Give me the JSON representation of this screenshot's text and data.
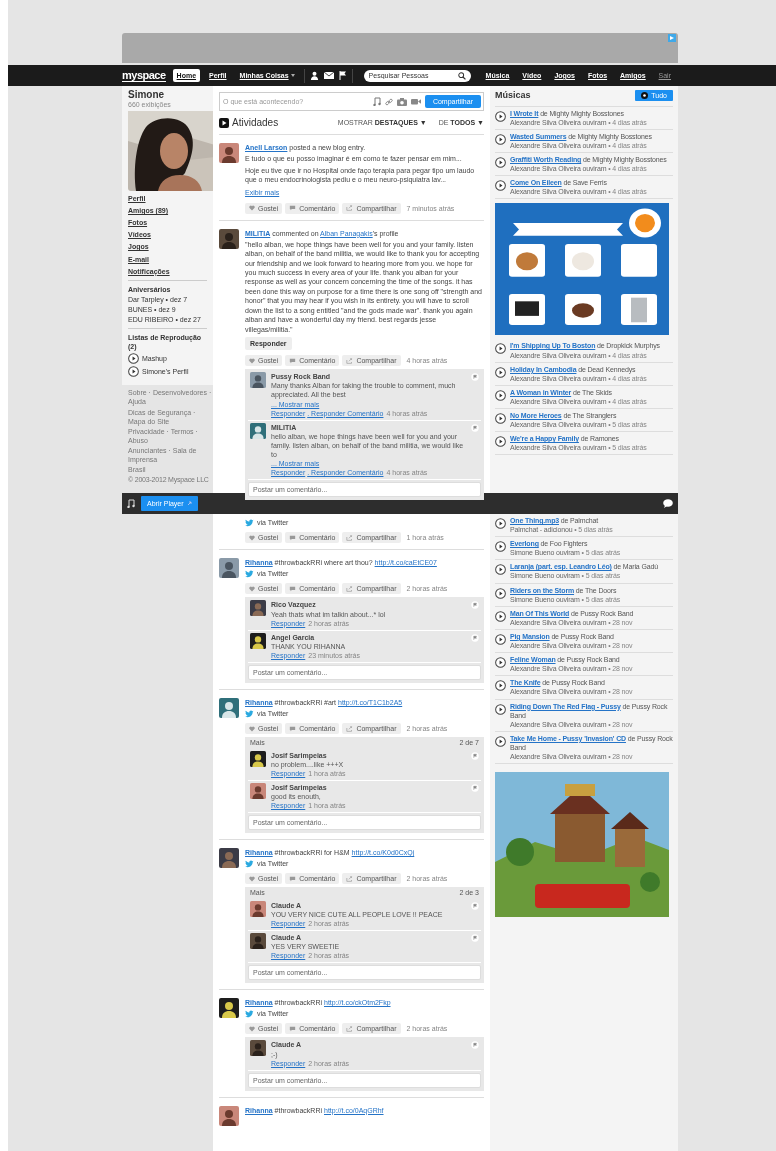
{
  "navbar": {
    "logo": "myspace",
    "links": [
      {
        "label": "Home",
        "selected": true,
        "dropdown": false
      },
      {
        "label": "Perfil",
        "selected": false,
        "dropdown": false
      },
      {
        "label": "Minhas Coisas",
        "selected": false,
        "dropdown": true
      }
    ],
    "search": {
      "placeholder": "Pesquisar Pessoas"
    },
    "sections": [
      "Música",
      "Vídeo",
      "Jogos",
      "Fotos",
      "Amigos"
    ],
    "logout": "Sair"
  },
  "profile": {
    "name": "Simone",
    "views": "660 exibições",
    "menu": [
      "Perfil",
      "Amigos (89)",
      "Fotos",
      "Vídeos",
      "Jogos",
      "E-mail",
      "Notificações"
    ],
    "birthdays": {
      "title": "Aniversários",
      "items": [
        "Dar Tarpley • dez 7",
        "BUNES • dez 9",
        "EDU RIBEIRO • dez 27"
      ]
    },
    "playlists": {
      "title": "Listas de Reprodução (2)",
      "items": [
        "Mashup",
        "Simone's Perfil"
      ]
    }
  },
  "footer": {
    "lines": [
      "Sobre · Desenvolvedores · Ajuda",
      "Dicas de Segurança · Mapa do Site",
      "Privacidade · Termos · Abuso",
      "Anunciantes · Sala de Imprensa"
    ],
    "country": "Brasil",
    "copyright": "© 2003-2012 Myspace LLC"
  },
  "composer": {
    "placeholder": "O que está acontecendo?",
    "button": "Compartilhar"
  },
  "activity": {
    "title": "Atividades",
    "show_label": "MOSTRAR",
    "show_value": "DESTAQUES ▼",
    "from_label": "DE",
    "from_value": "TODOS ▼",
    "posts": [
      {
        "kind": "blog",
        "author": "Anell Larson",
        "action": "posted a new blog entry.",
        "title": "E tudo o que eu posso imaginar é em como te fazer pensar em mim...",
        "text": "Hoje eu tive que ir no Hospital onde faço terapia para pegar tipo um laudo que o meu endocrinologista pediu e o meu neuro-psiquiatra lav...",
        "more": "Exibir mais",
        "actions": [
          "Gostei",
          "Comentário",
          "Compartilhar"
        ],
        "time": "7 minutos atrás"
      },
      {
        "kind": "comment",
        "author": "MILITIA",
        "action": "commented on",
        "target": "Alban Panagakis",
        "suffix": "'s profile",
        "text": "\"hello alban,  we hope things have been well for you and your family.   listen alban, on behalf of the band militia,   we would like to thank you for accepting our friendship and we look forward to hearing more from you.   we hope for you much success in every area of your life.  thank you alban for your response as well as your concern concerning the time of the songs.  it has been done this way on purpose for a time there is one song off \"strength and honor\" that you may hear if you wish in its entirety.  you will have to scroll down the list to a song entitled \"and the gods made war\".  thank you again alban and have a wonderful day my friend.   best regards jesse villegas/militia.\"",
        "reply": "Responder",
        "actions": [
          "Gostei",
          "Comentário",
          "Compartilhar"
        ],
        "time": "4 horas atrás",
        "comments": {
          "items": [
            {
              "author": "Pussy Rock Band",
              "text": "Many thanks Alban for taking the trouble to comment, much appreciated. All the best",
              "more": "... Mostrar mais",
              "reply": "Responder",
              "reply_comment": ". Responder Comentário",
              "time": "4 horas atrás"
            },
            {
              "author": "MILITIA",
              "text": "hello alban,  we hope things have been well for you and your family.   listen alban,  on behalf of the band militia,   we would like to",
              "more": "... Mostrar mais",
              "reply": "Responder",
              "reply_comment": ". Responder Comentário",
              "time": "4 horas atrás"
            }
          ],
          "placeholder": "Postar um comentário..."
        }
      },
      {
        "kind": "tweet",
        "via": "via Twitter",
        "actions": [
          "Gostei",
          "Comentário",
          "Compartilhar"
        ],
        "time": "1 hora atrás"
      },
      {
        "kind": "tweet",
        "author": "Rihanna",
        "text": "#throwbackRRi where art thou?",
        "link": "http://t.co/caEtCE07",
        "via": "via Twitter",
        "actions": [
          "Gostei",
          "Comentário",
          "Compartilhar"
        ],
        "time": "2 horas atrás",
        "comments": {
          "items": [
            {
              "author": "Rico Vazquez",
              "text": "Yeah thats what im talkin about...* lol",
              "reply": "Responder",
              "time": "2 horas atrás"
            },
            {
              "author": "Angel Garcia",
              "text": "THANK YOU RIHANNA",
              "reply": "Responder",
              "time": "23 minutos atrás"
            }
          ],
          "placeholder": "Postar um comentário..."
        }
      },
      {
        "kind": "tweet",
        "author": "Rihanna",
        "text": "#throwbackRRi #art",
        "link": "http://t.co/T1C1b2A5",
        "via": "via Twitter",
        "actions": [
          "Gostei",
          "Comentário",
          "Compartilhar"
        ],
        "time": "2 horas atrás",
        "comments": {
          "more": "Mais",
          "count": "2 de 7",
          "items": [
            {
              "author": "Josif Sarimpeias",
              "text": "no problem....like +++X",
              "reply": "Responder",
              "time": "1 hora atrás"
            },
            {
              "author": "Josif Sarimpeias",
              "text": "good its enouth,",
              "reply": "Responder",
              "time": "1 hora atrás"
            }
          ],
          "placeholder": "Postar um comentário..."
        }
      },
      {
        "kind": "tweet",
        "author": "Rihanna",
        "text": "#throwbackRRi for H&M",
        "link": "http://t.co/K0d0CxQj",
        "via": "via Twitter",
        "actions": [
          "Gostei",
          "Comentário",
          "Compartilhar"
        ],
        "time": "2 horas atrás",
        "comments": {
          "more": "Mais",
          "count": "2 de 3",
          "items": [
            {
              "author": "Claude A",
              "text": "YOU VERY NICE CUTE ALL PEOPLE LOVE !! PEACE",
              "reply": "Responder",
              "time": "2 horas atrás"
            },
            {
              "author": "Claude A",
              "text": "YES VERY SWEETIE",
              "reply": "Responder",
              "time": "2 horas atrás"
            }
          ],
          "placeholder": "Postar um comentário..."
        }
      },
      {
        "kind": "tweet",
        "author": "Rihanna",
        "text": "#throwbackRRi",
        "link": "http://t.co/ckOtm2Fkp",
        "via": "via Twitter",
        "actions": [
          "Gostei",
          "Comentário",
          "Compartilhar"
        ],
        "time": "2 horas atrás",
        "comments": {
          "items": [
            {
              "author": "Claude A",
              "text": ";-)",
              "reply": "Responder",
              "time": "2 horas atrás"
            }
          ],
          "placeholder": "Postar um comentário..."
        }
      },
      {
        "kind": "tweet",
        "author": "Rihanna",
        "text": "#throwbackRRi",
        "link": "http://t.co/0AqGRhf"
      }
    ]
  },
  "music": {
    "title": "Músicas",
    "button": "Tudo",
    "songs": [
      {
        "title": "I Wrote It",
        "by": "de Mighty Mighty Bosstones",
        "sub": "Alexandre Silva Oliveira ouviram",
        "time": "• 4 dias atrás"
      },
      {
        "title": "Wasted Summers",
        "by": "de Mighty Mighty Bosstones",
        "sub": "Alexandre Silva Oliveira ouviram",
        "time": "• 4 dias atrás"
      },
      {
        "title": "Graffiti Worth Reading",
        "by": "de Mighty Mighty Bosstones",
        "sub": "Alexandre Silva Oliveira ouviram",
        "time": "• 4 dias atrás"
      },
      {
        "title": "Come On Eileen",
        "by": "de Save Ferris",
        "sub": "Alexandre Silva Oliveira ouviram",
        "time": "• 4 dias atrás"
      },
      {
        "title": "I'm Shipping Up To Boston",
        "by": "de Dropkick Murphys",
        "sub": "Alexandre Silva Oliveira ouviram",
        "time": "• 4 dias atrás"
      },
      {
        "title": "Holiday In Cambodia",
        "by": "de Dead Kennedys",
        "sub": "Alexandre Silva Oliveira ouviram",
        "time": "• 4 dias atrás"
      },
      {
        "title": "A Woman in Winter",
        "by": "de The Skids",
        "sub": "Alexandre Silva Oliveira ouviram",
        "time": "• 4 dias atrás"
      },
      {
        "title": "No More Heroes",
        "by": "de The Stranglers",
        "sub": "Alexandre Silva Oliveira ouviram",
        "time": "• 5 dias atrás"
      },
      {
        "title": "We're a Happy Family",
        "by": "de Ramones",
        "sub": "Alexandre Silva Oliveira ouviram",
        "time": "• 5 dias atrás"
      },
      {
        "title": "One Thing.mp3",
        "by": "de Palmchat",
        "sub": "Palmchat - adicionou",
        "time": "• 5 dias atrás"
      },
      {
        "title": "Everlong",
        "by": "de Foo Fighters",
        "sub": "Simone Bueno ouviram",
        "time": "• 5 dias atrás"
      },
      {
        "title": "Laranja (part. esp. Leandro Léo)",
        "by": "de Maria Gadú",
        "sub": "Simone Bueno ouviram",
        "time": "• 5 dias atrás"
      },
      {
        "title": "Riders on the Storm",
        "by": "de The Doors",
        "sub": "Simone Bueno ouviram",
        "time": "• 5 dias atrás"
      },
      {
        "title": "Man Of This World",
        "by": "de Pussy Rock Band",
        "sub": "Alexandre Silva Oliveira ouviram",
        "time": "• 28 nov"
      },
      {
        "title": "Pig Mansion",
        "by": "de Pussy Rock Band",
        "sub": "Alexandre Silva Oliveira ouviram",
        "time": "• 28 nov"
      },
      {
        "title": "Feline Woman",
        "by": "de Pussy Rock Band",
        "sub": "Alexandre Silva Oliveira ouviram",
        "time": "• 28 nov"
      },
      {
        "title": "The Knife",
        "by": "de Pussy Rock Band",
        "sub": "Alexandre Silva Oliveira ouviram",
        "time": "• 28 nov"
      },
      {
        "title": "Riding Down The Red Flag - Pussy",
        "by": "de Pussy Rock Band",
        "sub": "Alexandre Silva Oliveira ouviram",
        "time": "• 28 nov"
      },
      {
        "title": "Take Me Home - Pussy 'Invasion' CD",
        "by": "de Pussy Rock Band",
        "sub": "Alexandre Silva Oliveira ouviram",
        "time": "• 28 nov"
      }
    ]
  },
  "player": {
    "button": "Abrir Player"
  }
}
